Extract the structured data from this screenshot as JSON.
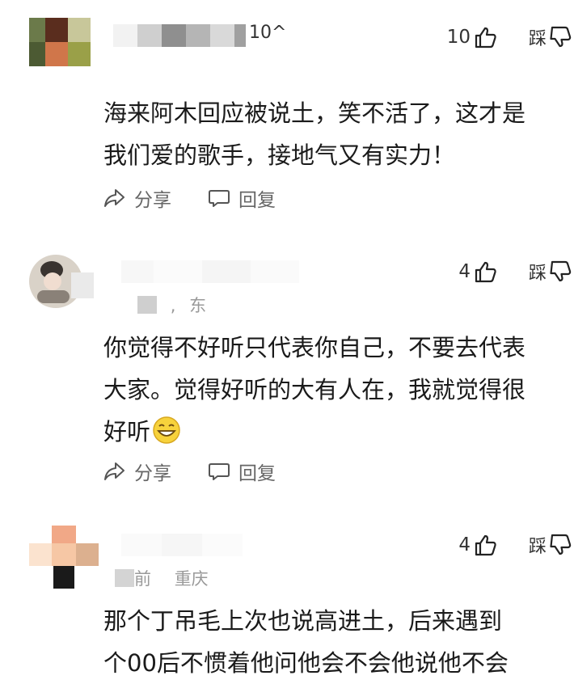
{
  "comments": [
    {
      "id": 1,
      "username_visible": "10^",
      "location": "",
      "likes": "10",
      "dislike_label": "踩",
      "text_lines": [
        "海来阿木回应被说土，笑不活了，这才是",
        "我们爱的歌手，接地气又有实力！"
      ],
      "share_label": "分享",
      "reply_label": "回复"
    },
    {
      "id": 2,
      "location": "东",
      "likes": "4",
      "dislike_label": "踩",
      "text_lines": [
        "你觉得不好听只代表你自己，不要去代表",
        "大家。觉得好听的大有人在，我就觉得很",
        "好听"
      ],
      "emoji": "grin-emoji",
      "share_label": "分享",
      "reply_label": "回复"
    },
    {
      "id": 3,
      "time": "前",
      "location": "重庆",
      "likes": "4",
      "dislike_label": "踩",
      "text_lines": [
        "那个丁吊毛上次也说高进土，后来遇到",
        "个00后不惯着他问他会不会他说他不会"
      ]
    }
  ],
  "colors": {
    "text": "#1a1a1a",
    "meta": "#9a9a9a",
    "action": "#666666",
    "background": "#ffffff"
  }
}
